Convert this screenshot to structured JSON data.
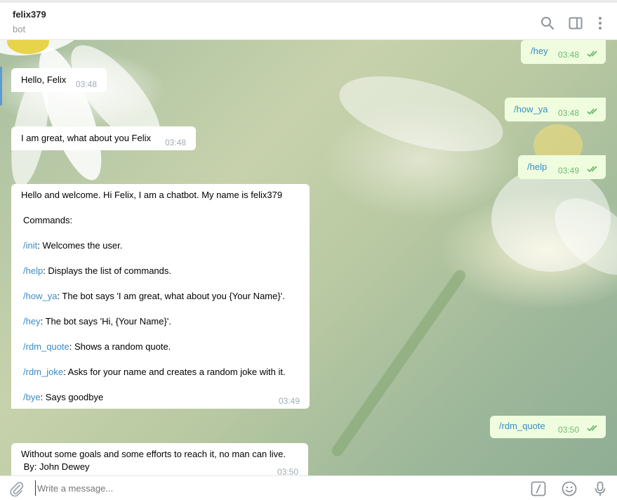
{
  "header": {
    "title": "felix379",
    "subtitle": "bot"
  },
  "messages": [
    {
      "dir": "out",
      "text": "/hey",
      "time": "03:48"
    },
    {
      "dir": "in",
      "text": "Hello, Felix",
      "time": "03:48"
    },
    {
      "dir": "out",
      "text": "/how_ya",
      "time": "03:48"
    },
    {
      "dir": "in",
      "text": "I am great, what about you Felix",
      "time": "03:48"
    },
    {
      "dir": "out",
      "text": "/help",
      "time": "03:49"
    },
    {
      "dir": "out",
      "text": "/rdm_quote",
      "time": "03:50"
    }
  ],
  "help_message": {
    "intro": "Hello and welcome. Hi Felix, I am a chatbot. My name is felix379",
    "commands_label": "Commands:",
    "commands": [
      {
        "cmd": "/init",
        "desc": ": Welcomes the user."
      },
      {
        "cmd": "/help",
        "desc": ": Displays the list of commands."
      },
      {
        "cmd": "/how_ya",
        "desc": ": The bot says 'I am great, what about you {Your Name}'."
      },
      {
        "cmd": "/hey",
        "desc": ": The bot says 'Hi, {Your Name}'."
      },
      {
        "cmd": "/rdm_quote",
        "desc": ": Shows a random quote."
      },
      {
        "cmd": "/rdm_joke",
        "desc": ": Asks for your name and creates a random joke with it."
      },
      {
        "cmd": "/bye",
        "desc": ": Says goodbye"
      }
    ],
    "time": "03:49"
  },
  "quote_message": {
    "line1": "Without some goals and some efforts to reach it, no man can live.",
    "line2": " By: John Dewey",
    "time": "03:50"
  },
  "composer": {
    "placeholder": "Write a message..."
  },
  "icons": {
    "search": "search-icon",
    "sidebar": "sidebar-toggle-icon",
    "menu": "more-vertical-icon",
    "attach": "paperclip-icon",
    "commands": "slash-command-icon",
    "emoji": "emoji-icon",
    "mic": "microphone-icon"
  }
}
